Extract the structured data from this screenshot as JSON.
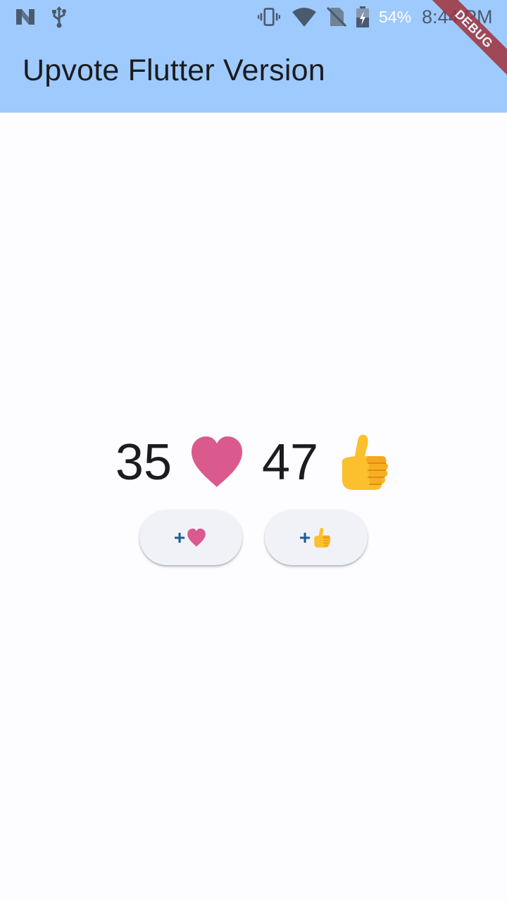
{
  "status_bar": {
    "battery_percent": "54%",
    "time": "8:44 PM",
    "icons": [
      "n-logo-icon",
      "usb-icon",
      "vibrate-icon",
      "wifi-icon",
      "no-sim-icon",
      "battery-charging-icon"
    ]
  },
  "app_bar": {
    "title": "Upvote Flutter Version",
    "background_color": "#9fcafe"
  },
  "debug_banner": {
    "label": "DEBUG"
  },
  "counters": {
    "hearts": "35",
    "thumbs": "47"
  },
  "buttons": {
    "add_heart_prefix": "+",
    "add_thumb_prefix": "+"
  },
  "colors": {
    "heart": "#db5a8e",
    "thumb": "#fbc02d",
    "accent_text": "#1a5f92",
    "button_bg": "#f1f2f8"
  }
}
